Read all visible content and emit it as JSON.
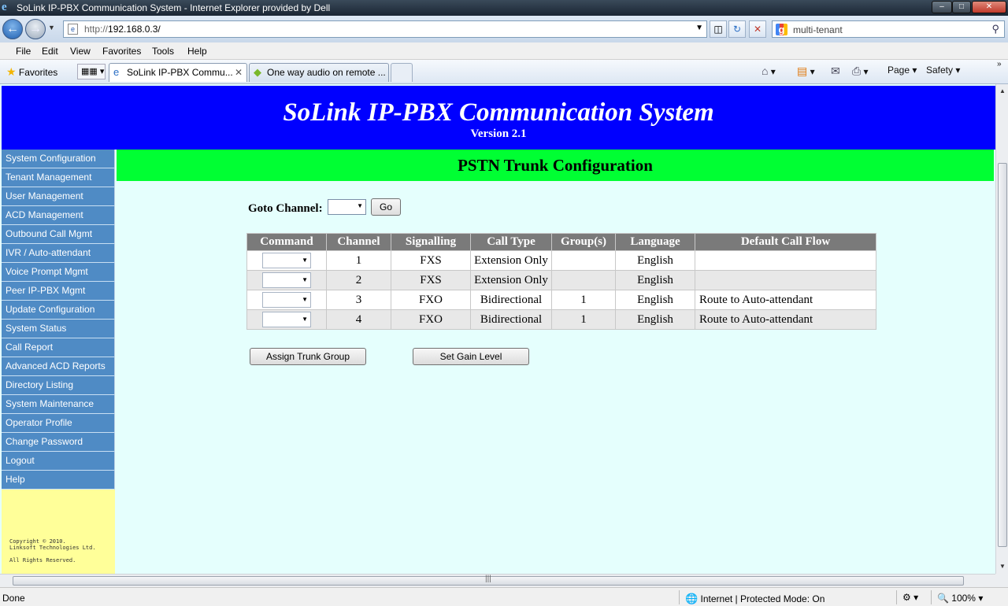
{
  "window": {
    "title": "SoLink IP-PBX Communication System - Internet Explorer provided by Dell",
    "minimize": "–",
    "maximize": "□",
    "close": "✕"
  },
  "browser": {
    "address": {
      "prefix": "http://",
      "host": "192.168.0.3/"
    },
    "search_text": "multi-tenant",
    "menu": [
      "File",
      "Edit",
      "View",
      "Favorites",
      "Tools",
      "Help"
    ],
    "favorites_label": "Favorites",
    "tabs": [
      {
        "label": "SoLink IP-PBX Commu...",
        "active": true
      },
      {
        "label": "One way audio on remote ...",
        "active": false
      }
    ],
    "commands": {
      "page": "Page ▾",
      "safety": "Safety ▾"
    },
    "status": {
      "left": "Done",
      "zone": "Internet | Protected Mode: On",
      "zoom": "100%"
    },
    "icons": {
      "back": "back-arrow-icon",
      "forward": "forward-arrow-icon",
      "refresh": "refresh-icon",
      "stop": "stop-icon",
      "home": "home-icon",
      "feeds": "feeds-icon",
      "print": "print-icon",
      "search": "search-icon"
    }
  },
  "app": {
    "title": "SoLink IP-PBX Communication System",
    "version": "Version 2.1",
    "heading": "PSTN Trunk Configuration",
    "nav": [
      "System Configuration",
      "Tenant Management",
      "User Management",
      "ACD Management",
      "Outbound Call Mgmt",
      "IVR / Auto-attendant",
      "Voice Prompt Mgmt",
      "Peer IP-PBX Mgmt",
      "Update Configuration",
      "System Status",
      "Call Report",
      "Advanced ACD Reports",
      "Directory Listing",
      "System Maintenance",
      "Operator Profile",
      "Change Password",
      "Logout",
      "Help"
    ],
    "copyright": {
      "line1": "Copyright © 2010.",
      "line2": "Linksoft Technologies Ltd.",
      "line3": "All Rights Reserved."
    },
    "goto_label": "Goto Channel:",
    "go_button": "Go",
    "table": {
      "headers": [
        "Command",
        "Channel",
        "Signalling",
        "Call Type",
        "Group(s)",
        "Language",
        "Default Call Flow"
      ],
      "rows": [
        {
          "channel": "1",
          "signalling": "FXS",
          "call_type": "Extension Only",
          "groups": "",
          "language": "English",
          "flow": ""
        },
        {
          "channel": "2",
          "signalling": "FXS",
          "call_type": "Extension Only",
          "groups": "",
          "language": "English",
          "flow": ""
        },
        {
          "channel": "3",
          "signalling": "FXO",
          "call_type": "Bidirectional",
          "groups": "1",
          "language": "English",
          "flow": "Route to Auto-attendant"
        },
        {
          "channel": "4",
          "signalling": "FXO",
          "call_type": "Bidirectional",
          "groups": "1",
          "language": "English",
          "flow": "Route to Auto-attendant"
        }
      ]
    },
    "buttons": {
      "assign": "Assign Trunk Group",
      "gain": "Set Gain Level"
    },
    "colors": {
      "banner": "#0000ff",
      "heading": "#00ff33",
      "nav": "#4f8bc5",
      "content_bg": "#e5fffd",
      "copyright_bg": "#ffff99"
    }
  }
}
